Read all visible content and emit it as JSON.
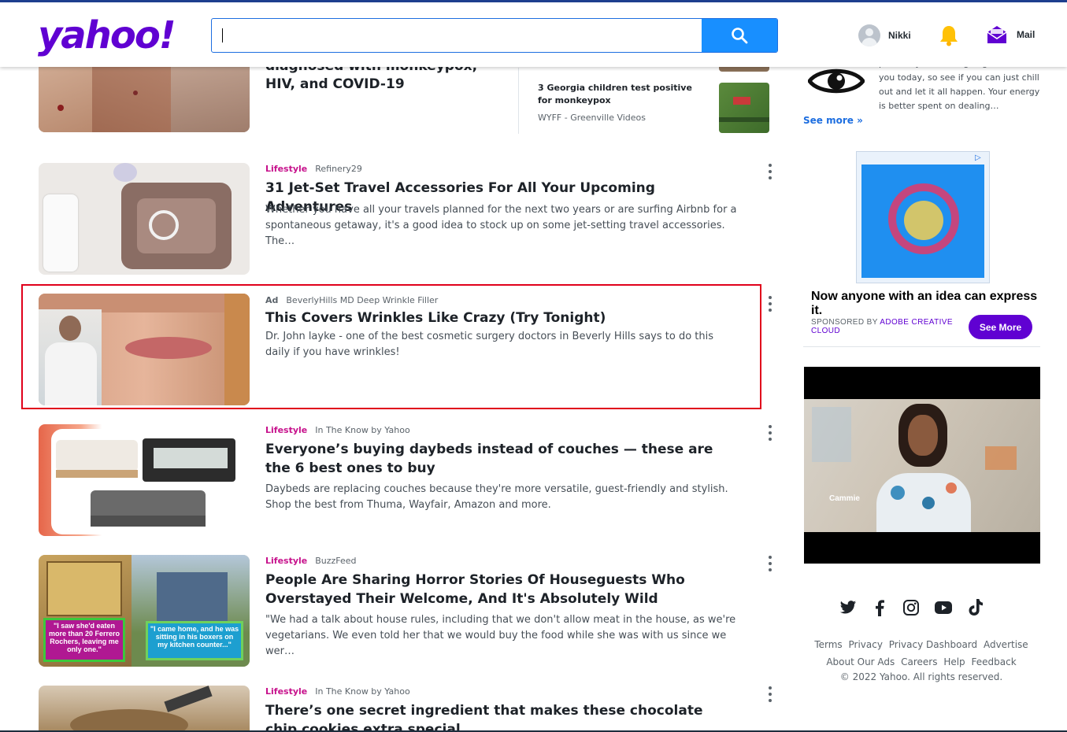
{
  "header": {
    "logo": "yahoo!",
    "search": {
      "value": "",
      "placeholder": ""
    },
    "user_name": "Nikki",
    "mail_label": "Mail"
  },
  "top_story": {
    "title_line1": "diagnosed with monkeypox,",
    "title_line2": "HIV, and COVID-19",
    "related": {
      "title": "3 Georgia children test positive for monkeypox",
      "source": "WYFF - Greenville Videos"
    }
  },
  "feed": [
    {
      "category": "Lifestyle",
      "source": "Refinery29",
      "title": "31 Jet-Set Travel Accessories For All Your Upcoming Adventures",
      "summary": "Whether you have all your travels planned for the next two years or are surfing Airbnb for a spontaneous getaway, it's a good idea to stock up on some jet-setting travel accessories. The…"
    },
    {
      "category": "Ad",
      "source": "BeverlyHills MD Deep Wrinkle Filler",
      "title": "This Covers Wrinkles Like Crazy (Try Tonight)",
      "summary": "Dr. John layke - one of the best cosmetic surgery doctors in Beverly Hills says to do this daily if you have wrinkles!"
    },
    {
      "category": "Lifestyle",
      "source": "In The Know by Yahoo",
      "title": "Everyone’s buying daybeds instead of couches — these are the 6 best ones to buy",
      "summary": "Daybeds are replacing couches because they're more versatile, guest-friendly and stylish. Shop the best from Thuma, Wayfair, Amazon and more."
    },
    {
      "category": "Lifestyle",
      "source": "BuzzFeed",
      "title": "People Are Sharing Horror Stories Of Houseguests Who Overstayed Their Welcome, And It's Absolutely Wild",
      "summary": "\"We had a talk about house rules, including that we don't allow meat in the house, as we're vegetarians. We even told her that we would buy the food while she was with us since we wer…",
      "thumb_caption_left": "\"I saw she'd eaten more than 20 Ferrero Rochers, leaving me only one.\"",
      "thumb_caption_right": "\"I came home, and he was sitting in his boxers on my kitchen counter...\""
    },
    {
      "category": "Lifestyle",
      "source": "In The Know by Yahoo",
      "title": "There’s one secret ingredient that makes these chocolate chip cookies extra special"
    }
  ],
  "sidebar": {
    "horoscope_text": "put off by all that's going on around you today, so see if you can just chill out and let it all happen. Your energy is better spent on dealing…",
    "see_more": "See more »",
    "ad": {
      "headline": "Now anyone with an idea can express it.",
      "sponsored_prefix": "SPONSORED BY",
      "advertiser": "ADOBE CREATIVE CLOUD",
      "button": "See More"
    },
    "video": {
      "name": "Cammie"
    }
  },
  "footer": {
    "row1": [
      "Terms",
      "Privacy",
      "Privacy Dashboard",
      "Advertise"
    ],
    "row2": [
      "About Our Ads",
      "Careers",
      "Help",
      "Feedback"
    ],
    "copyright": "© 2022 Yahoo. All rights reserved."
  },
  "colors": {
    "brand_purple": "#6001d2",
    "search_blue": "#188fff",
    "category_pink": "#c7128c",
    "ad_highlight_red": "#e0001b"
  }
}
